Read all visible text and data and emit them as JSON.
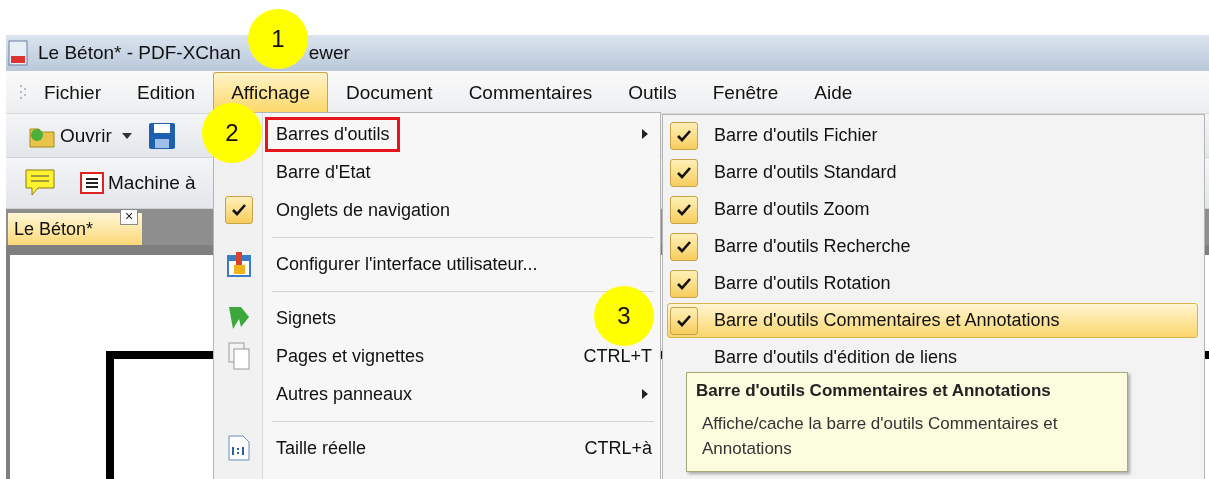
{
  "window": {
    "title_parts": [
      "Le Béton* - PDF-XChan",
      "ewer"
    ]
  },
  "menu_bar": [
    {
      "label": "Fichier",
      "selected": false
    },
    {
      "label": "Edition",
      "selected": false
    },
    {
      "label": "Affichage",
      "selected": true
    },
    {
      "label": "Document",
      "selected": false
    },
    {
      "label": "Commentaires",
      "selected": false
    },
    {
      "label": "Outils",
      "selected": false
    },
    {
      "label": "Fenêtre",
      "selected": false
    },
    {
      "label": "Aide",
      "selected": false
    }
  ],
  "toolbar": {
    "open_button": "Ouvrir",
    "typewriter_button": "Machine à"
  },
  "document_tabs": [
    {
      "label": "Le Béton*",
      "close": "×",
      "selected": true
    }
  ],
  "view_menu": [
    {
      "kind": "submenu",
      "label": "Barres d'outils",
      "annotated": true
    },
    {
      "kind": "command",
      "label": "Barre d'Etat"
    },
    {
      "kind": "check",
      "label": "Onglets de navigation",
      "checked": true
    },
    {
      "kind": "separator"
    },
    {
      "kind": "command",
      "label": "Configurer l'interface utilisateur..."
    },
    {
      "kind": "separator"
    },
    {
      "kind": "command",
      "label": "Signets"
    },
    {
      "kind": "command",
      "label": "Pages et vignettes",
      "shortcut": "CTRL+T"
    },
    {
      "kind": "submenu",
      "label": "Autres panneaux",
      "annotated": false
    },
    {
      "kind": "separator"
    },
    {
      "kind": "command",
      "label": "Taille réelle",
      "shortcut": "CTRL+à"
    }
  ],
  "toolbars_submenu": [
    {
      "label": "Barre d'outils Fichier",
      "checked": true,
      "selected": false
    },
    {
      "label": "Barre d'outils Standard",
      "checked": true,
      "selected": false
    },
    {
      "label": "Barre d'outils Zoom",
      "checked": true,
      "selected": false
    },
    {
      "label": "Barre d'outils Recherche",
      "checked": true,
      "selected": false
    },
    {
      "label": "Barre d'outils Rotation",
      "checked": true,
      "selected": false
    },
    {
      "label": "Barre d'outils Commentaires et Annotations",
      "checked": true,
      "selected": true
    },
    {
      "label": "Barre d'outils d'édition de liens",
      "checked": false,
      "selected": false
    }
  ],
  "tooltip": {
    "title": "Barre d'outils Commentaires et Annotations",
    "text": "Affiche/cache la barre d'outils Commentaires et Annotations"
  },
  "callouts": [
    {
      "label": "1"
    },
    {
      "label": "2"
    },
    {
      "label": "3"
    }
  ]
}
